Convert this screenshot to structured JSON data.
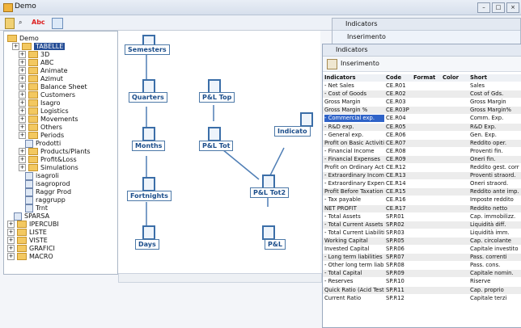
{
  "app": {
    "title": "Demo"
  },
  "toolbar": {
    "abc": "Abc"
  },
  "tree": [
    {
      "label": "Demo",
      "type": "root"
    },
    {
      "label": "TABELLE",
      "type": "folder",
      "selected": true
    },
    {
      "label": "3D",
      "type": "folder"
    },
    {
      "label": "ABC",
      "type": "folder"
    },
    {
      "label": "Animate",
      "type": "folder"
    },
    {
      "label": "Azimut",
      "type": "folder"
    },
    {
      "label": "Balance Sheet",
      "type": "folder"
    },
    {
      "label": "Customers",
      "type": "folder"
    },
    {
      "label": "Isagro",
      "type": "folder"
    },
    {
      "label": "Logistics",
      "type": "folder"
    },
    {
      "label": "Movements",
      "type": "folder"
    },
    {
      "label": "Others",
      "type": "folder"
    },
    {
      "label": "Periods",
      "type": "folder"
    },
    {
      "label": "Prodotti",
      "type": "doc"
    },
    {
      "label": "Products/Plants",
      "type": "folder"
    },
    {
      "label": "Profit&Loss",
      "type": "folder"
    },
    {
      "label": "Simulations",
      "type": "folder"
    },
    {
      "label": "isagroli",
      "type": "doc"
    },
    {
      "label": "isagroprod",
      "type": "doc"
    },
    {
      "label": "Raggr Prod",
      "type": "doc"
    },
    {
      "label": "raggrupp",
      "type": "doc"
    },
    {
      "label": "Trnt",
      "type": "doc"
    },
    {
      "label": "SPARSA",
      "type": "doc"
    },
    {
      "label": "IPERCUBI",
      "type": "folder"
    },
    {
      "label": "LISTE",
      "type": "folder"
    },
    {
      "label": "VISTE",
      "type": "folder"
    },
    {
      "label": "GRAFICI",
      "type": "folder"
    },
    {
      "label": "MACRO",
      "type": "folder"
    }
  ],
  "diagram": {
    "nodes": [
      "Semesters",
      "Quarters",
      "Months",
      "Fortnights",
      "Days",
      "P&L Top",
      "P&L Tot",
      "P&L Tot2",
      "P&L",
      "Indicato"
    ]
  },
  "back_window": {
    "title": "Indicators",
    "button": "Inserimento"
  },
  "window": {
    "title": "Indicators",
    "button": "Inserimento"
  },
  "table": {
    "headers": [
      "Indicators",
      "Code",
      "Format",
      "Color",
      "Short"
    ],
    "rows": [
      [
        "- Net Sales",
        "CE.R01",
        "",
        "",
        "Sales"
      ],
      [
        "- Cost of Goods",
        "CE.R02",
        "",
        "",
        "Cost of Gds."
      ],
      [
        "Gross Margin",
        "CE.R03",
        "",
        "",
        "Gross Margin"
      ],
      [
        "Gross Margin %",
        "CE.R03P",
        "",
        "",
        "Gross Margin%"
      ],
      [
        "- Commercial exp.",
        "CE.R04",
        "",
        "",
        "Comm. Exp."
      ],
      [
        "- R&D exp.",
        "CE.R05",
        "",
        "",
        "R&D Exp."
      ],
      [
        "- General exp.",
        "CE.R06",
        "",
        "",
        "Gen. Exp."
      ],
      [
        "Profit on Basic Activities",
        "CE.R07",
        "",
        "",
        "Reddito oper."
      ],
      [
        "- Financial Income",
        "CE.R08",
        "",
        "",
        "Proventi fin."
      ],
      [
        "- Financial Expenses",
        "CE.R09",
        "",
        "",
        "Oneri fin."
      ],
      [
        "Profit on Ordinary Activities",
        "CE.R12",
        "",
        "",
        "Reddito gest. corr"
      ],
      [
        "- Extraordinary Income",
        "CE.R13",
        "",
        "",
        "Proventi straord."
      ],
      [
        "- Extraordinary Expenses",
        "CE.R14",
        "",
        "",
        "Oneri straord."
      ],
      [
        "Profit Before Taxation",
        "CE.R15",
        "",
        "",
        "Reddito ante imp."
      ],
      [
        "- Tax payable",
        "CE.R16",
        "",
        "",
        "Imposte reddito"
      ],
      [
        "NET PROFIT",
        "CE.R17",
        "",
        "",
        "Reddito netto"
      ],
      [
        "- Total Assets",
        "SP.R01",
        "",
        "",
        "Cap. immobilizz."
      ],
      [
        "- Total Current Assets",
        "SP.R02",
        "",
        "",
        "Liquidità diff."
      ],
      [
        "- Total Current Liabilities",
        "SP.R03",
        "",
        "",
        "Liquidità imm."
      ],
      [
        "Working Capital",
        "SP.R05",
        "",
        "",
        "Cap. circolante"
      ],
      [
        "Invested Capital",
        "SP.R06",
        "",
        "",
        "Capitale investito"
      ],
      [
        "- Long term liabilities",
        "SP.R07",
        "",
        "",
        "Pass. correnti"
      ],
      [
        "- Other long term liabilities",
        "SP.R08",
        "",
        "",
        "Pass. cons."
      ],
      [
        "- Total Capital",
        "SP.R09",
        "",
        "",
        "Capitale nomin."
      ],
      [
        "- Reserves",
        "SP.R10",
        "",
        "",
        "Riserve"
      ],
      [
        "Quick Ratio (Acid Test)",
        "SP.R11",
        "",
        "",
        "Cap. proprio"
      ],
      [
        "Current Ratio",
        "SP.R12",
        "",
        "",
        "Capitale terzi"
      ]
    ]
  }
}
